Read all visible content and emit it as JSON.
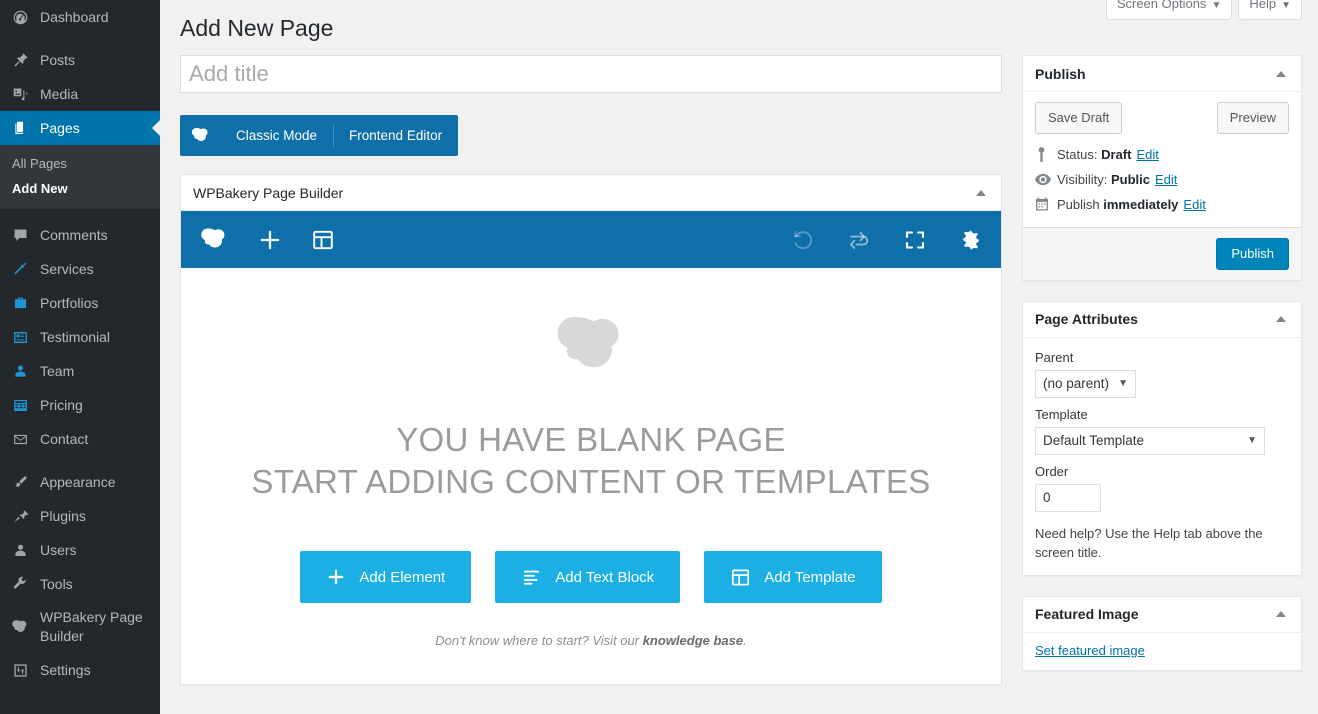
{
  "sidebar": {
    "items": [
      {
        "label": "Dashboard",
        "icon": "dashboard-icon",
        "current": false
      },
      {
        "label": "Posts",
        "icon": "pin-icon",
        "current": false
      },
      {
        "label": "Media",
        "icon": "media-icon",
        "current": false
      },
      {
        "label": "Pages",
        "icon": "pages-icon",
        "current": true
      },
      {
        "label": "Comments",
        "icon": "comments-icon",
        "current": false
      },
      {
        "label": "Services",
        "icon": "hammer-icon",
        "current": false
      },
      {
        "label": "Portfolios",
        "icon": "portfolio-icon",
        "current": false
      },
      {
        "label": "Testimonial",
        "icon": "testimonial-icon",
        "current": false
      },
      {
        "label": "Team",
        "icon": "user-icon",
        "current": false
      },
      {
        "label": "Pricing",
        "icon": "pricing-table-icon",
        "current": false
      },
      {
        "label": "Contact",
        "icon": "envelope-icon",
        "current": false
      },
      {
        "label": "Appearance",
        "icon": "brush-icon",
        "current": false
      },
      {
        "label": "Plugins",
        "icon": "plug-icon",
        "current": false
      },
      {
        "label": "Users",
        "icon": "users-icon",
        "current": false
      },
      {
        "label": "Tools",
        "icon": "wrench-icon",
        "current": false
      },
      {
        "label": "WPBakery Page Builder",
        "icon": "wpbakery-cloud-icon",
        "current": false
      },
      {
        "label": "Settings",
        "icon": "settings-sliders-icon",
        "current": false
      }
    ],
    "submenu": [
      {
        "label": "All Pages",
        "current": false
      },
      {
        "label": "Add New",
        "current": true
      }
    ]
  },
  "screen_meta": {
    "screen_options": "Screen Options",
    "help": "Help",
    "caret": "▼"
  },
  "header": {
    "page_title": "Add New Page"
  },
  "editor": {
    "title_placeholder": "Add title",
    "title_value": "",
    "mode_switch": {
      "logo_icon": "wpbakery-cloud-icon",
      "classic": "Classic Mode",
      "frontend": "Frontend Editor"
    },
    "metabox_title": "WPBakery Page Builder",
    "toolbar": {
      "logo": "wpbakery-cloud-icon",
      "add_element": "plus-icon",
      "add_template": "template-grid-icon",
      "undo": "undo-icon",
      "redo": "redo-icon",
      "fullscreen": "fullscreen-icon",
      "settings": "gear-icon"
    },
    "empty_state": {
      "logo_icon": "wpbakery-cloud-icon",
      "line1": "YOU HAVE BLANK PAGE",
      "line2": "START ADDING CONTENT OR TEMPLATES",
      "buttons": [
        {
          "label": "Add Element",
          "icon": "plus-icon"
        },
        {
          "label": "Add Text Block",
          "icon": "text-lines-icon"
        },
        {
          "label": "Add Template",
          "icon": "template-grid-icon"
        }
      ],
      "hint_prefix": "Don't know where to start? Visit our ",
      "hint_link": "knowledge base",
      "hint_suffix": "."
    }
  },
  "publish_box": {
    "title": "Publish",
    "save_draft": "Save Draft",
    "preview": "Preview",
    "status_label": "Status:",
    "status_value": "Draft",
    "visibility_label": "Visibility:",
    "visibility_value": "Public",
    "schedule_label": "Publish",
    "schedule_value": "immediately",
    "edit": "Edit",
    "publish": "Publish"
  },
  "page_attributes": {
    "title": "Page Attributes",
    "parent_label": "Parent",
    "parent_value": "(no parent)",
    "template_label": "Template",
    "template_value": "Default Template",
    "order_label": "Order",
    "order_value": "0",
    "help_text": "Need help? Use the Help tab above the screen title."
  },
  "featured_image": {
    "title": "Featured Image",
    "set_link": "Set featured image"
  },
  "colors": {
    "admin_blue": "#0073aa",
    "vc_dark_blue": "#0f6fa8",
    "vc_light_blue": "#1bafe4",
    "sidebar_bg": "#23282d",
    "submenu_bg": "#32373c",
    "page_bg": "#f1f1f1"
  }
}
